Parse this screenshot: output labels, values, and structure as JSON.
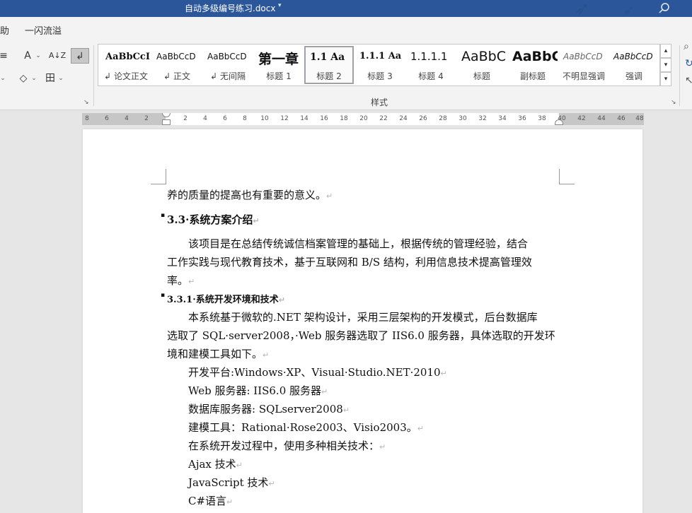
{
  "window": {
    "title": "自动多级编号练习.docx",
    "colors": {
      "titlebar": "#2b579a",
      "ribbon": "#f3f3f3",
      "page": "#ffffff",
      "canvas": "#e6e6e6"
    }
  },
  "tabs": [
    {
      "label": "助"
    },
    {
      "label": "一闪流溢"
    }
  ],
  "ribbon": {
    "group_label": "样式",
    "styles": [
      {
        "sample": "AaBbCcI",
        "name": "论文正文",
        "mark": "↲"
      },
      {
        "sample": "AaBbCcD",
        "name": "正文",
        "mark": "↲"
      },
      {
        "sample": "AaBbCcD",
        "name": "无间隔",
        "mark": "↲"
      },
      {
        "sample": "第一章",
        "name": "标题 1",
        "mark": ""
      },
      {
        "sample": "1.1 Aa",
        "name": "标题 2",
        "mark": "",
        "selected": true
      },
      {
        "sample": "1.1.1 Aa",
        "name": "标题 3",
        "mark": ""
      },
      {
        "sample": "1.1.1.1",
        "name": "标题 4",
        "mark": ""
      },
      {
        "sample": "AaBbC",
        "name": "标题",
        "mark": ""
      },
      {
        "sample": "AaBbC",
        "name": "副标题",
        "mark": ""
      },
      {
        "sample": "AaBbCcD",
        "name": "不明显强调",
        "mark": ""
      },
      {
        "sample": "AaBbCcD",
        "name": "强调",
        "mark": ""
      }
    ],
    "tools": {
      "list_icon": "≡",
      "font_color": "A",
      "sort": "A↓Z",
      "pilcrow": "↲",
      "shading": "◇",
      "borders": "田",
      "caret": "⌄"
    },
    "icons": {
      "search": "search-icon",
      "launcher": "↘",
      "scroll_up": "▴",
      "scroll_down": "▾",
      "expand": "▾"
    }
  },
  "ruler": {
    "ticks": [
      "8",
      "6",
      "4",
      "2",
      "2",
      "4",
      "6",
      "8",
      "10",
      "12",
      "14",
      "16",
      "18",
      "20",
      "22",
      "24",
      "26",
      "28",
      "30",
      "32",
      "34",
      "36",
      "38",
      "40",
      "42",
      "44",
      "46",
      "48"
    ]
  },
  "document": {
    "paragraph_mark": "↵",
    "paragraphs": [
      {
        "text": "养的质量的提高也有重要的意义。",
        "kind": "body"
      },
      {
        "text": "3.3·系统方案介绍",
        "kind": "h2",
        "bullet": "▪"
      },
      {
        "text": "　　该项目是在总结传统诚信档案管理的基础上，根据传统的管理经验，结合",
        "kind": "body"
      },
      {
        "text": "工作实践与现代教育技术，基于互联网和 B/S 结构，利用信息技术提高管理效",
        "kind": "body"
      },
      {
        "text": "率。",
        "kind": "body"
      },
      {
        "text": "3.3.1·系统开发环境和技术",
        "kind": "h3",
        "bullet": "▪"
      },
      {
        "text": "　　本系统基于微软的.NET 架构设计，采用三层架构的开发模式，后台数据库",
        "kind": "body"
      },
      {
        "text": "选取了 SQL·server2008，·Web 服务器选取了 IIS6.0 服务器，具体选取的开发环",
        "kind": "body"
      },
      {
        "text": "境和建模工具如下。",
        "kind": "body"
      },
      {
        "text": "　　开发平台:Windows·XP、Visual·Studio.NET·2010",
        "kind": "body"
      },
      {
        "text": "　　Web 服务器: IIS6.0 服务器",
        "kind": "body"
      },
      {
        "text": "　　数据库服务器: SQLserver2008",
        "kind": "body"
      },
      {
        "text": "　　建模工具：Rational·Rose2003、Visio2003。",
        "kind": "body"
      },
      {
        "text": "　　在系统开发过程中，使用多种相关技术：",
        "kind": "body"
      },
      {
        "text": "　　Ajax 技术",
        "kind": "body"
      },
      {
        "text": "　　JavaScript 技术",
        "kind": "body"
      },
      {
        "text": "　　C#语言",
        "kind": "body"
      }
    ]
  }
}
